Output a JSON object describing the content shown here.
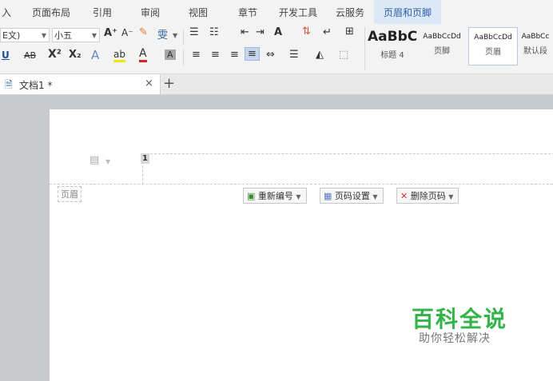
{
  "menu": {
    "items": [
      "入",
      "页面布局",
      "引用",
      "审阅",
      "视图",
      "章节",
      "开发工具",
      "云服务"
    ],
    "active": "页眉和页脚"
  },
  "ribbon": {
    "font_name": "E文)",
    "font_size": "小五",
    "grow_font": "A⁺",
    "shrink_font": "A⁻",
    "phonetic": "雯",
    "underline": "U",
    "strike": "AB",
    "superscript": "X²",
    "subscript": "X₂",
    "text_effect": "A",
    "highlight": "ab",
    "font_color": "A",
    "char_shade": "A",
    "styles": [
      {
        "sample": "AaBbC",
        "name": "标题 4"
      },
      {
        "sample": "AaBbCcDd",
        "name": "页脚"
      },
      {
        "sample": "AaBbCcDd",
        "name": "页眉"
      },
      {
        "sample": "AaBbCc",
        "name": "默认段"
      }
    ]
  },
  "tabs": {
    "doc_title": "文档1 *",
    "close": "×",
    "new_tab": "+"
  },
  "header_area": {
    "page_number": "1",
    "header_label": "页眉",
    "buttons": {
      "renumber": "重新编号",
      "page_setup": "页码设置",
      "delete": "删除页码"
    }
  },
  "watermark": {
    "title": "百科全说",
    "subtitle": "助你轻松解决"
  },
  "colors": {
    "accent": "#2a5ea8",
    "watermark_green": "#33b34a",
    "delete_red": "#d9302c",
    "highlight_yellow": "#f5e400",
    "font_red": "#e02020"
  }
}
